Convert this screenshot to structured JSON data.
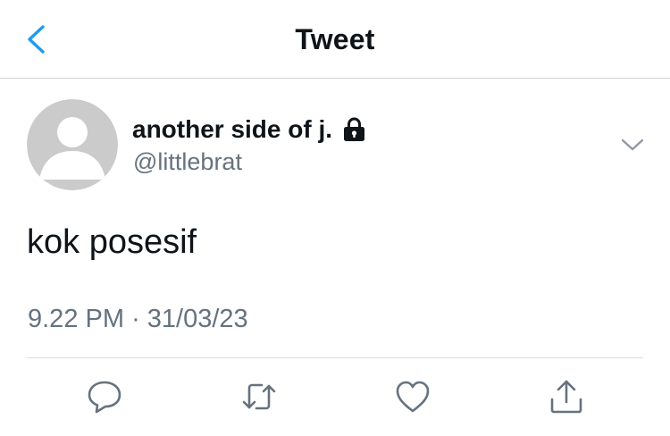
{
  "header": {
    "title": "Tweet",
    "back_icon": "chevron-left-icon"
  },
  "colors": {
    "accent": "#1d9bf0",
    "muted": "#66727e",
    "text": "#0f1419",
    "divider": "#dcdcdf"
  },
  "tweet": {
    "author_name": "another side of j.",
    "protected": true,
    "handle": "@littlebrat",
    "text": "kok posesif",
    "time": "9.22 PM",
    "separator": "·",
    "date": "31/03/23"
  },
  "actions": [
    {
      "name": "reply",
      "icon": "reply-icon"
    },
    {
      "name": "retweet",
      "icon": "retweet-icon"
    },
    {
      "name": "like",
      "icon": "heart-icon"
    },
    {
      "name": "share",
      "icon": "share-icon"
    }
  ]
}
